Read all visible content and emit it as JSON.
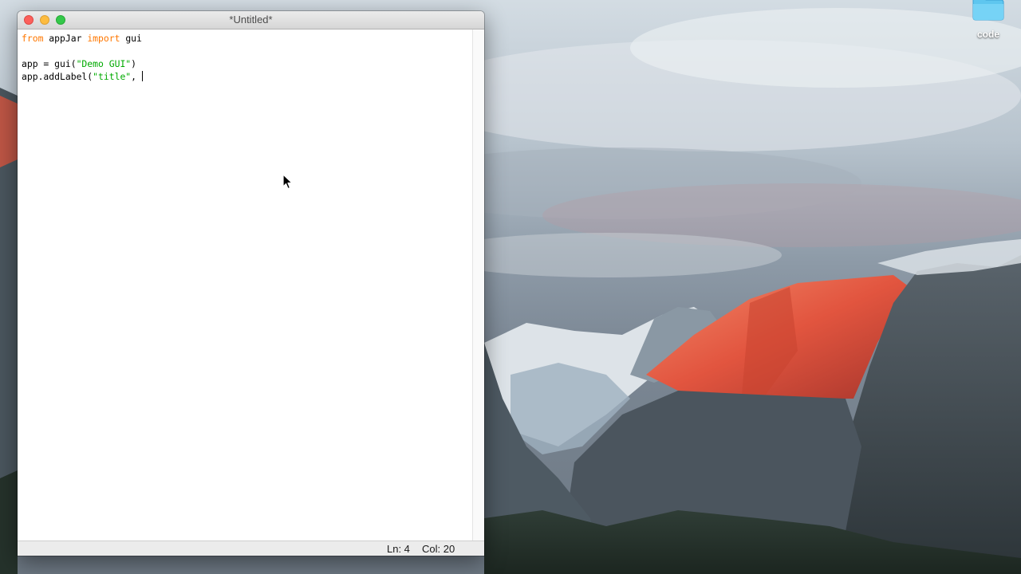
{
  "desktop": {
    "folder_label": "code",
    "folder_color": "#5ec6ef"
  },
  "window": {
    "title": "*Untitled*",
    "controls": {
      "close_color": "#fc605b",
      "minimize_color": "#fdbc40",
      "zoom_color": "#34c84a"
    }
  },
  "editor": {
    "lines": [
      [
        {
          "text": "from",
          "type": "keyword"
        },
        {
          "text": " appJar ",
          "type": "plain"
        },
        {
          "text": "import",
          "type": "keyword"
        },
        {
          "text": " gui",
          "type": "plain"
        }
      ],
      [],
      [
        {
          "text": "app = gui(",
          "type": "plain"
        },
        {
          "text": "\"Demo GUI\"",
          "type": "string"
        },
        {
          "text": ")",
          "type": "plain"
        }
      ],
      [
        {
          "text": "app.addLabel(",
          "type": "plain"
        },
        {
          "text": "\"title\"",
          "type": "string"
        },
        {
          "text": ", ",
          "type": "plain"
        }
      ]
    ],
    "syntax_colors": {
      "keyword": "#ff7700",
      "string": "#00aa00",
      "plain": "#000000"
    }
  },
  "status": {
    "line": "Ln: 4",
    "column": "Col: 20"
  }
}
